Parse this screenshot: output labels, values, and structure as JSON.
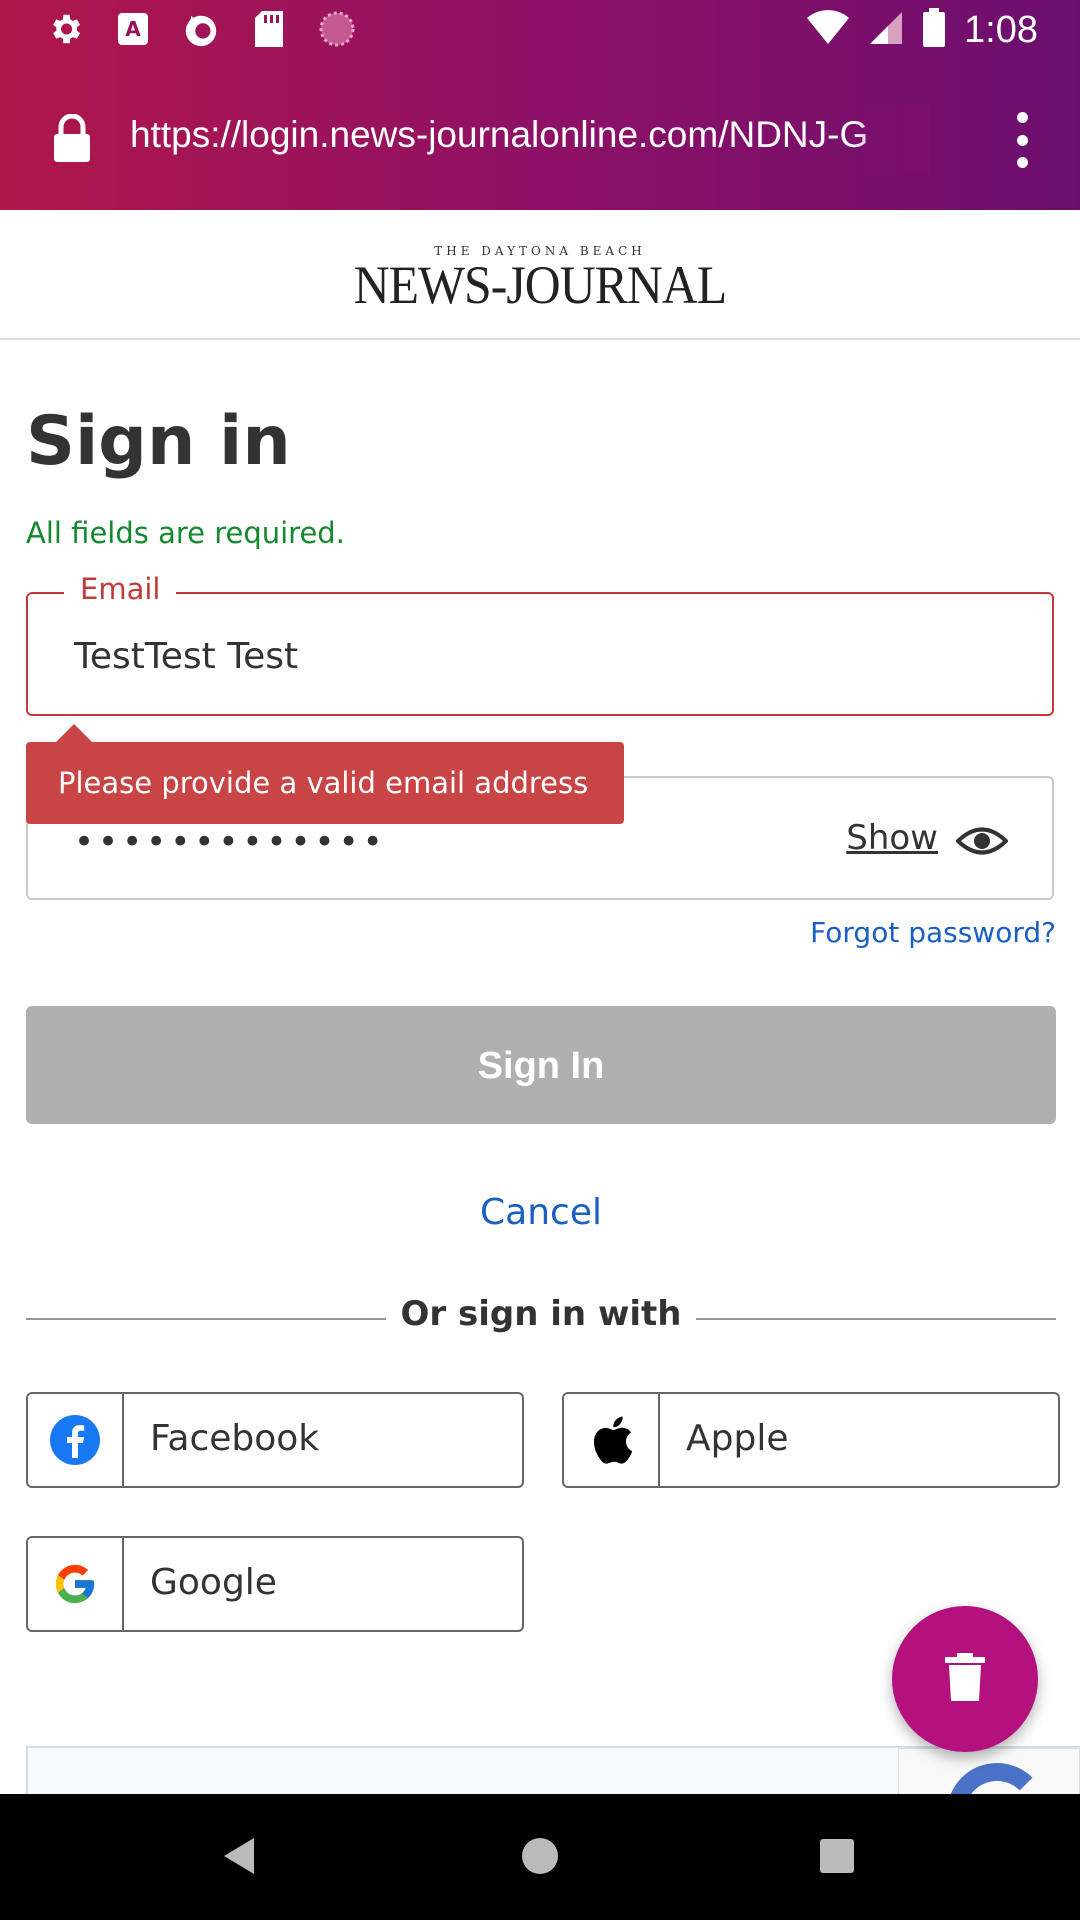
{
  "status_bar": {
    "time": "1:08",
    "icons": [
      "settings-icon",
      "text-a-icon",
      "firefox-icon",
      "sd-card-icon",
      "loading-icon",
      "wifi-icon",
      "signal-icon",
      "battery-icon"
    ]
  },
  "browser": {
    "url": "https://login.news-journalonline.com/NDNJ-G",
    "menu_icon": "more-vert-icon",
    "gradient_colors": [
      "#b0174b",
      "#6b0f6f"
    ]
  },
  "header": {
    "logo_top": "THE DAYTONA BEACH",
    "logo_main": "NEWS-JOURNAL"
  },
  "form": {
    "title": "Sign in",
    "required_note": "All fields are required.",
    "email_label": "Email",
    "email_value": "TestTest Test",
    "error_tooltip": "Please provide a valid email address",
    "password_value": "•••••••••••••",
    "show_label": "Show",
    "forgot_label": "Forgot password?",
    "signin_label": "Sign In",
    "cancel_label": "Cancel",
    "divider_text": "Or sign in with"
  },
  "social": {
    "facebook": "Facebook",
    "apple": "Apple",
    "google": "Google"
  },
  "colors": {
    "error": "#c23a3a",
    "success": "#148a2e",
    "link": "#1a5fc2",
    "fab": "#b5117e",
    "disabled_button": "#b0b0b0"
  },
  "fab": {
    "icon": "trash-icon"
  }
}
